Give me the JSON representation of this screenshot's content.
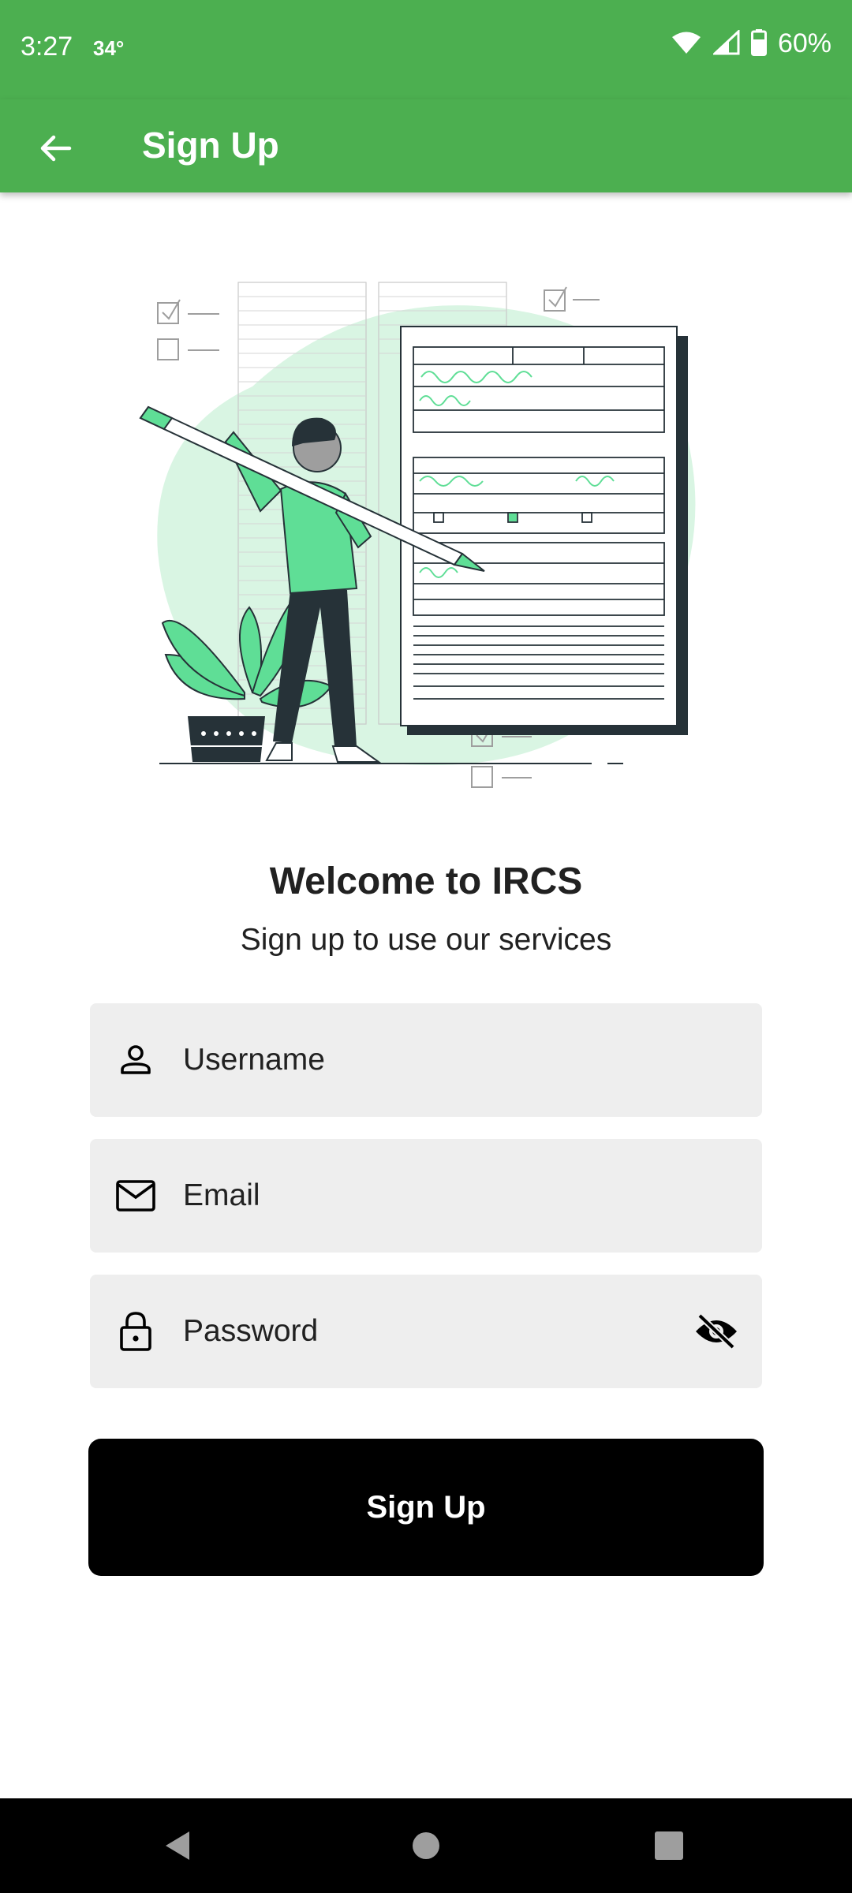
{
  "status_bar": {
    "time": "3:27",
    "temperature": "34°",
    "battery": "60%",
    "icons": [
      "wifi-icon",
      "signal-icon",
      "battery-icon"
    ]
  },
  "app_bar": {
    "title": "Sign Up",
    "back_icon": "arrow-back-icon"
  },
  "welcome": {
    "title": "Welcome to IRCS",
    "subtitle": "Sign up to use our services"
  },
  "form": {
    "username": {
      "placeholder": "Username",
      "value": "",
      "icon": "person-icon"
    },
    "email": {
      "placeholder": "Email",
      "value": "",
      "icon": "mail-icon"
    },
    "password": {
      "placeholder": "Password",
      "value": "",
      "icon": "lock-icon",
      "toggle_icon": "visibility-off-icon"
    }
  },
  "submit": {
    "label": "Sign Up"
  },
  "colors": {
    "primary": "#4caf50",
    "accent_illustration": "#5fde96",
    "field_bg": "#eeeeee",
    "button_bg": "#000000"
  }
}
